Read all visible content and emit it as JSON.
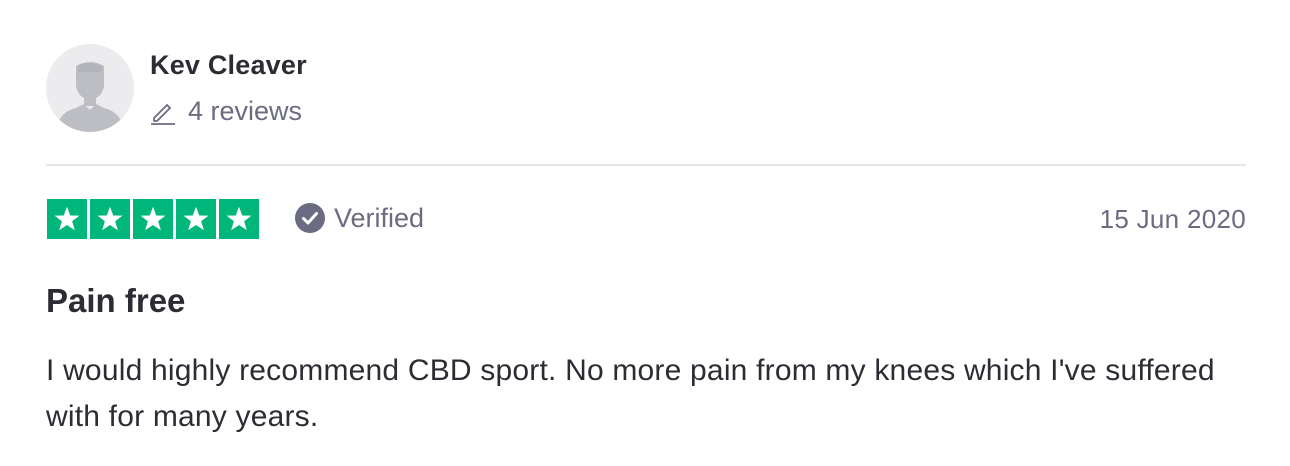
{
  "reviewer": {
    "name": "Kev Cleaver",
    "reviews_count": "4 reviews",
    "avatar_icon": "person-silhouette-icon",
    "review_icon": "pencil-icon"
  },
  "rating": {
    "stars": 5,
    "max_stars": 5,
    "star_color": "#00b67a",
    "star_icon": "star-icon"
  },
  "verification": {
    "label": "Verified",
    "icon": "check-circle-icon"
  },
  "review": {
    "date": "15 Jun 2020",
    "title": "Pain free",
    "body": "I would highly recommend CBD sport. No more pain from my knees which I've suffered with for many years."
  }
}
